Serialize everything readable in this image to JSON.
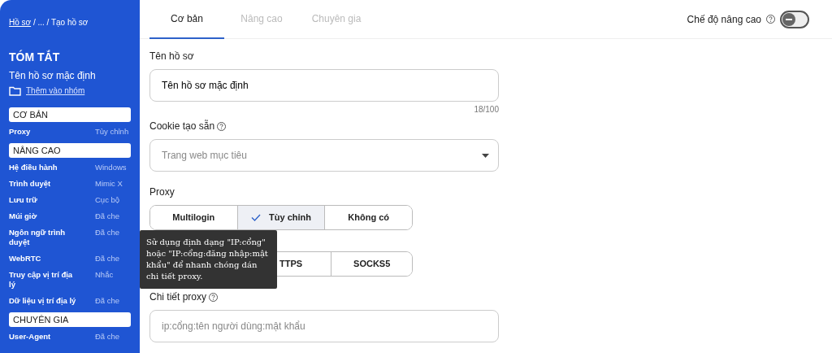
{
  "sidebar": {
    "breadcrumb": [
      {
        "label": "Hồ sơ",
        "link": true
      },
      {
        "label": "/ ... / Tạo hồ sơ",
        "link": false
      }
    ],
    "summary_title": "TÓM TẮT",
    "profile_name": "Tên hồ sơ mặc định",
    "add_to_group": "Thêm vào nhóm",
    "sections": [
      {
        "title": "CƠ BẢN",
        "rows": [
          {
            "label": "Proxy",
            "value": "Tùy chỉnh"
          }
        ]
      },
      {
        "title": "NÂNG CAO",
        "rows": [
          {
            "label": "Hệ điều hành",
            "value": "Windows"
          },
          {
            "label": "Trình duyệt",
            "value": "Mimic X"
          },
          {
            "label": "Lưu trữ",
            "value": "Cục bộ"
          },
          {
            "label": "Múi giờ",
            "value": "Đã che"
          },
          {
            "label": "Ngôn ngữ trình duyệt",
            "value": "Đã che"
          },
          {
            "label": "WebRTC",
            "value": "Đã che"
          },
          {
            "label": "Truy cập vị trí địa lý",
            "value": "Nhắc"
          },
          {
            "label": "Dữ liệu vị trí địa lý",
            "value": "Đã che"
          }
        ]
      },
      {
        "title": "CHUYÊN GIA",
        "rows": [
          {
            "label": "User-Agent",
            "value": "Đã che"
          }
        ]
      }
    ]
  },
  "tabs": [
    {
      "label": "Cơ bản",
      "selected": true
    },
    {
      "label": "Nâng cao",
      "selected": false
    },
    {
      "label": "Chuyên gia",
      "selected": false
    }
  ],
  "advanced_mode": {
    "label": "Chế độ nâng cao",
    "on": false
  },
  "profile_name": {
    "label": "Tên hồ sơ",
    "value": "Tên hồ sơ mặc định",
    "counter": "18/100"
  },
  "cookie": {
    "label": "Cookie tạo sẵn",
    "placeholder": "Trang web mục tiêu"
  },
  "proxy": {
    "label": "Proxy",
    "options": [
      {
        "label": "Multilogin",
        "selected": false
      },
      {
        "label": "Tùy chỉnh",
        "selected": true
      },
      {
        "label": "Không có",
        "selected": false
      }
    ]
  },
  "protocol": {
    "options": [
      {
        "label": "TTPS"
      },
      {
        "label": "SOCKS5"
      }
    ]
  },
  "tooltip": "Sử dụng định dạng \"IP:cổng\" hoặc \"IP:cổng:đăng nhập:mật khẩu\" để nhanh chóng dán chi tiết proxy.",
  "proxy_details": {
    "label": "Chi tiết proxy",
    "placeholder": "ip:cổng:tên người dùng:mật khẩu"
  }
}
